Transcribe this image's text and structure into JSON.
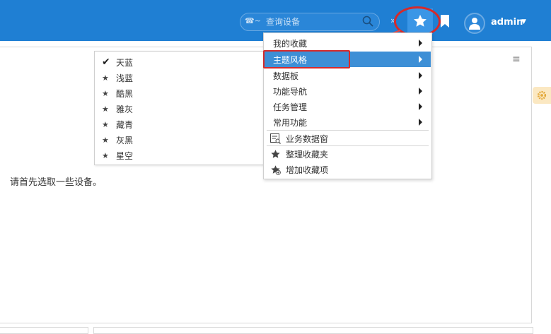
{
  "header": {
    "search_prefix": "☎∼",
    "search_placeholder": "查询设备",
    "username": "admin"
  },
  "main": {
    "empty_message": "请首先选取一些设备。"
  },
  "theme_menu": {
    "items": [
      {
        "label": "天蓝",
        "icon": "check-icon",
        "checked": true
      },
      {
        "label": "浅蓝",
        "icon": "star-icon",
        "checked": false
      },
      {
        "label": "酷黑",
        "icon": "star-icon",
        "checked": false
      },
      {
        "label": "雅灰",
        "icon": "star-icon",
        "checked": false
      },
      {
        "label": "藏青",
        "icon": "star-icon",
        "checked": false
      },
      {
        "label": "灰黑",
        "icon": "star-icon",
        "checked": false
      },
      {
        "label": "星空",
        "icon": "star-icon",
        "checked": false
      }
    ]
  },
  "fav_menu": {
    "submenus": [
      {
        "label": "我的收藏"
      },
      {
        "label": "主题风格",
        "active": true
      },
      {
        "label": "数据板"
      },
      {
        "label": "功能导航"
      },
      {
        "label": "任务管理"
      },
      {
        "label": "常用功能"
      }
    ],
    "actions": [
      {
        "label": "业务数据窗",
        "icon": "data-window-icon"
      },
      {
        "label": "整理收藏夹",
        "icon": "star-icon"
      },
      {
        "label": "增加收藏项",
        "icon": "star-add-icon"
      }
    ]
  },
  "colors": {
    "topbar": "#1f7fd3",
    "active_item": "#3d8fd6",
    "annotation_red": "#d62a2a",
    "gear_bg": "#fbe8c2"
  }
}
